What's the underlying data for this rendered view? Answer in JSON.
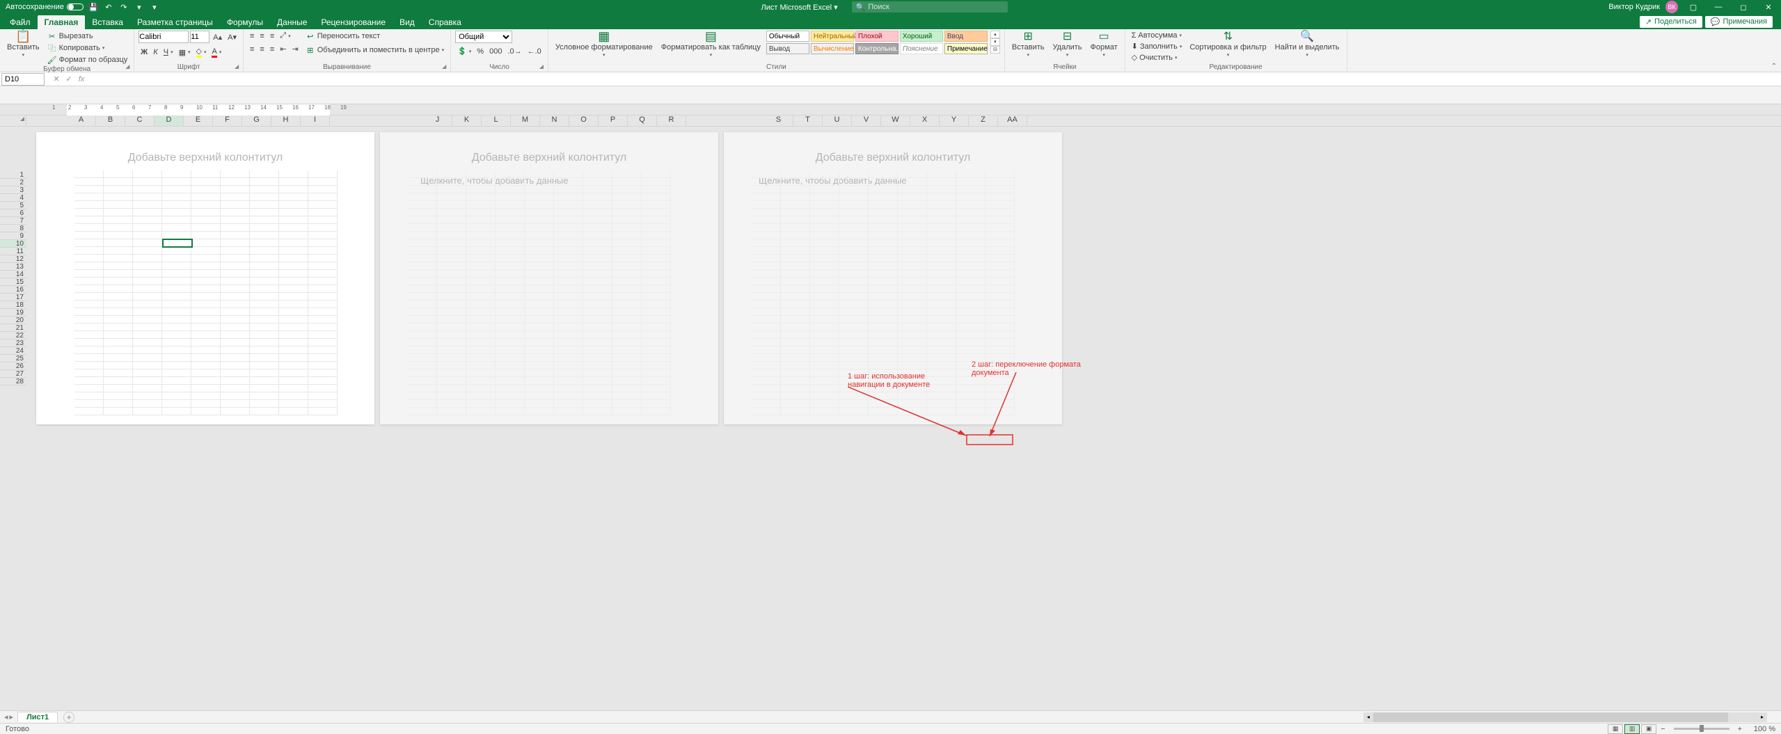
{
  "titlebar": {
    "autosave_label": "Автосохранение",
    "doc_title": "Лист Microsoft Excel",
    "search_placeholder": "Поиск",
    "user_name": "Виктор Кудрик",
    "user_initials": "ВК"
  },
  "tabs": {
    "items": [
      "Файл",
      "Главная",
      "Вставка",
      "Разметка страницы",
      "Формулы",
      "Данные",
      "Рецензирование",
      "Вид",
      "Справка"
    ],
    "active": 1,
    "share": "Поделиться",
    "comments": "Примечания"
  },
  "ribbon": {
    "clipboard": {
      "label": "Буфер обмена",
      "paste": "Вставить",
      "cut": "Вырезать",
      "copy": "Копировать",
      "format_painter": "Формат по образцу"
    },
    "font": {
      "label": "Шрифт",
      "name": "Calibri",
      "size": "11"
    },
    "align": {
      "label": "Выравнивание",
      "wrap": "Переносить текст",
      "merge": "Объединить и поместить в центре"
    },
    "number": {
      "label": "Число",
      "format": "Общий"
    },
    "styles": {
      "label": "Стили",
      "cond": "Условное форматирование",
      "table": "Форматировать как таблицу",
      "row1": [
        {
          "t": "Обычный",
          "bg": "#ffffff",
          "fg": "#000",
          "bd": "#bcbcbc"
        },
        {
          "t": "Нейтральный",
          "bg": "#ffeb9c",
          "fg": "#9c6500",
          "bd": "#e4cf80"
        },
        {
          "t": "Плохой",
          "bg": "#ffc7ce",
          "fg": "#9c0006",
          "bd": "#e8b0b6"
        },
        {
          "t": "Хороший",
          "bg": "#c6efce",
          "fg": "#006100",
          "bd": "#a9d8b1"
        },
        {
          "t": "Ввод",
          "bg": "#ffcc99",
          "fg": "#3f3f76",
          "bd": "#e4b685"
        }
      ],
      "row2": [
        {
          "t": "Вывод",
          "bg": "#f2f2f2",
          "fg": "#3f3f3f",
          "bd": "#b2b2b2"
        },
        {
          "t": "Вычисление",
          "bg": "#f2f2f2",
          "fg": "#fa7d00",
          "bd": "#b2b2b2"
        },
        {
          "t": "Контрольна...",
          "bg": "#a5a5a5",
          "fg": "#ffffff",
          "bd": "#888"
        },
        {
          "t": "Пояснение",
          "bg": "#ffffff",
          "fg": "#7f7f7f",
          "bd": "#e0e0e0",
          "it": true
        },
        {
          "t": "Примечание",
          "bg": "#ffffcc",
          "fg": "#000",
          "bd": "#b2b2b2"
        }
      ]
    },
    "cells": {
      "label": "Ячейки",
      "insert": "Вставить",
      "delete": "Удалить",
      "format": "Формат"
    },
    "editing": {
      "label": "Редактирование",
      "autosum": "Автосумма",
      "fill": "Заполнить",
      "clear": "Очистить",
      "sort": "Сортировка и фильтр",
      "find": "Найти и выделить"
    }
  },
  "namebox": "D10",
  "columns": [
    "A",
    "B",
    "C",
    "D",
    "E",
    "F",
    "G",
    "H",
    "I",
    "J",
    "K",
    "L",
    "M",
    "N",
    "O",
    "P",
    "Q",
    "R",
    "S",
    "T",
    "U",
    "V",
    "W",
    "X",
    "Y",
    "Z",
    "AA"
  ],
  "col_breaks": {
    "page1_end": 8,
    "page2_start": 9,
    "page2_end": 17,
    "page3_start": 18
  },
  "rows_visible": 28,
  "active_cell": {
    "col": "D",
    "row": 10
  },
  "page_hints": {
    "header": "Добавьте верхний колонтитул",
    "data": "Щелкните, чтобы добавить данные"
  },
  "sheets": {
    "active": "Лист1"
  },
  "status": {
    "ready": "Готово",
    "zoom": "100 %"
  },
  "annotations": {
    "a1": "1 шаг: использование навигации в документе",
    "a2": "2 шаг: переключение формата документа"
  }
}
